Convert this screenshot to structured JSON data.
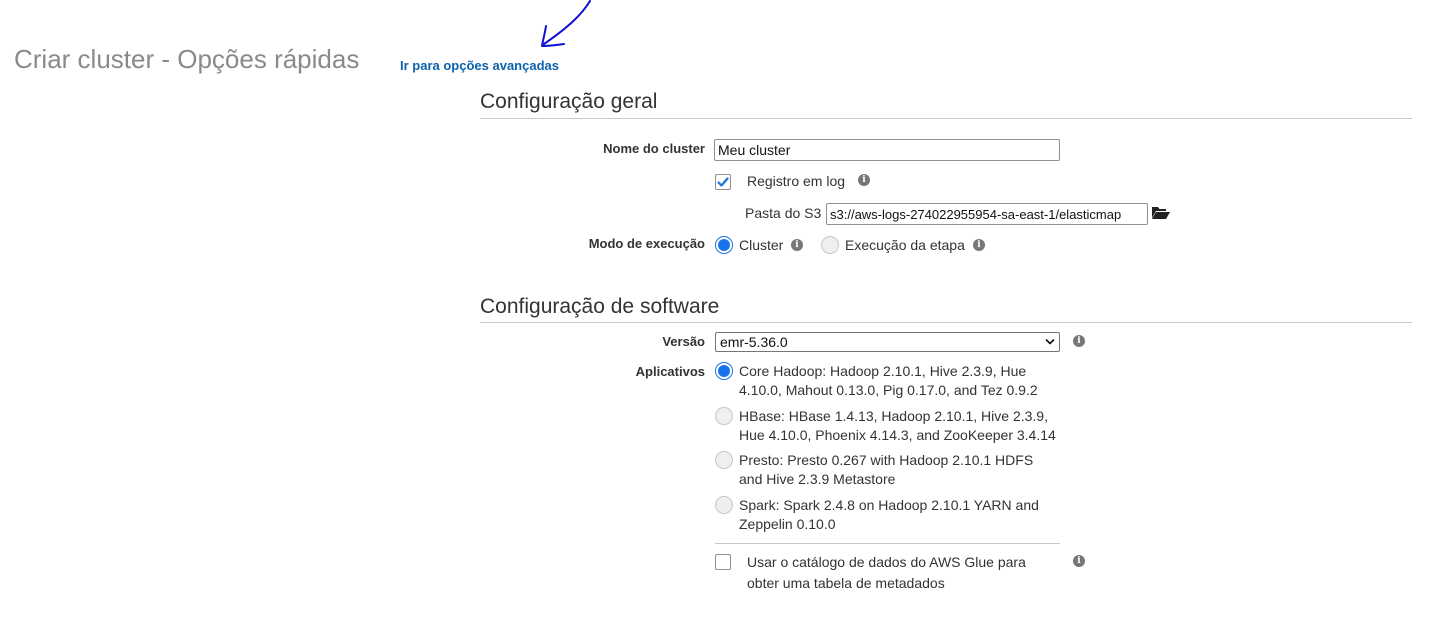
{
  "header": {
    "title": "Criar cluster - Opções rápidas",
    "advanced_link": "Ir para opções avançadas"
  },
  "general": {
    "section_title": "Configuração geral",
    "cluster_name": {
      "label": "Nome do cluster",
      "value": "Meu cluster"
    },
    "logging": {
      "label": "Registro em log",
      "checked": true
    },
    "s3_folder": {
      "label": "Pasta do S3",
      "value": "s3://aws-logs-274022955954-sa-east-1/elasticmap"
    },
    "launch_mode": {
      "label": "Modo de execução",
      "options": [
        {
          "label": "Cluster",
          "selected": true
        },
        {
          "label": "Execução da etapa",
          "selected": false
        }
      ]
    }
  },
  "software": {
    "section_title": "Configuração de software",
    "version": {
      "label": "Versão",
      "value": "emr-5.36.0"
    },
    "applications": {
      "label": "Aplicativos",
      "options": [
        {
          "line1": "Core Hadoop: Hadoop 2.10.1, Hive 2.3.9, Hue",
          "line2": "4.10.0, Mahout 0.13.0, Pig 0.17.0, and Tez 0.9.2",
          "selected": true
        },
        {
          "line1": "HBase: HBase 1.4.13, Hadoop 2.10.1, Hive 2.3.9,",
          "line2": "Hue 4.10.0, Phoenix 4.14.3, and ZooKeeper 3.4.14",
          "selected": false
        },
        {
          "line1": "Presto: Presto 0.267 with Hadoop 2.10.1 HDFS",
          "line2": "and Hive 2.3.9 Metastore",
          "selected": false
        },
        {
          "line1": "Spark: Spark 2.4.8 on Hadoop 2.10.1 YARN and",
          "line2": "Zeppelin 0.10.0",
          "selected": false
        }
      ]
    },
    "glue": {
      "line1": "Usar o catálogo de dados do AWS Glue para",
      "line2": "obter uma tabela de metadados",
      "checked": false
    }
  },
  "colors": {
    "accent": "#1a73e8",
    "link": "#0b62ad",
    "annotation": "#1010d0"
  },
  "icons": [
    "info-icon",
    "folder-open-icon",
    "checkmark-icon",
    "chevron-down-icon",
    "hand-drawn-arrow-icon"
  ]
}
